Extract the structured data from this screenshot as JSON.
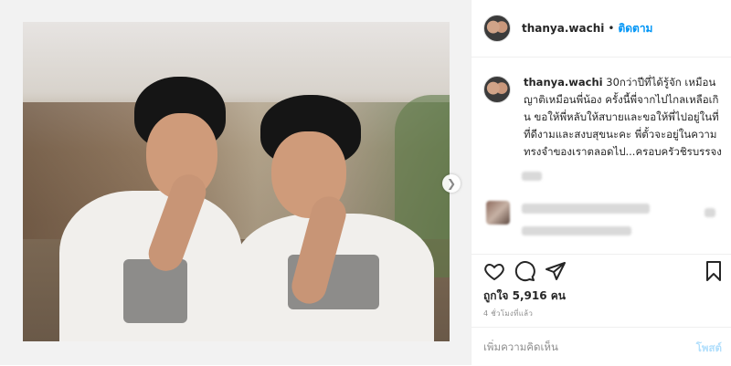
{
  "post": {
    "username": "thanya.wachi",
    "follow_label": "ติดตาม",
    "dot": "•",
    "caption": "30กว่าปีที่ได้รู้จัก เหมือนญาติเหมือนพี่น้อง ครั้งนี้พี่จากไปไกลเหลือเกิน ขอให้พี่หลับให้สบายและขอให้พี่ไปอยู่ในที่ที่ดีงามและสงบสุขนะคะ พี่ตั้วจะอยู่ในความทรงจำของเราตลอดไป...ครอบครัวชิรบรรจง",
    "likes": "ถูกใจ 5,916 คน",
    "time": "4 ชั่วโมงที่แล้ว",
    "add_comment_placeholder": "เพิ่มความคิดเห็น",
    "post_label": "โพสต์"
  },
  "icons": {
    "like": "heart-icon",
    "comment": "comment-icon",
    "share": "share-icon",
    "save": "bookmark-icon",
    "next": "chevron-right-icon"
  },
  "colors": {
    "accent": "#0095f6",
    "post_disabled": "#b2dffc",
    "text": "#262626",
    "muted": "#8e8e8e"
  }
}
